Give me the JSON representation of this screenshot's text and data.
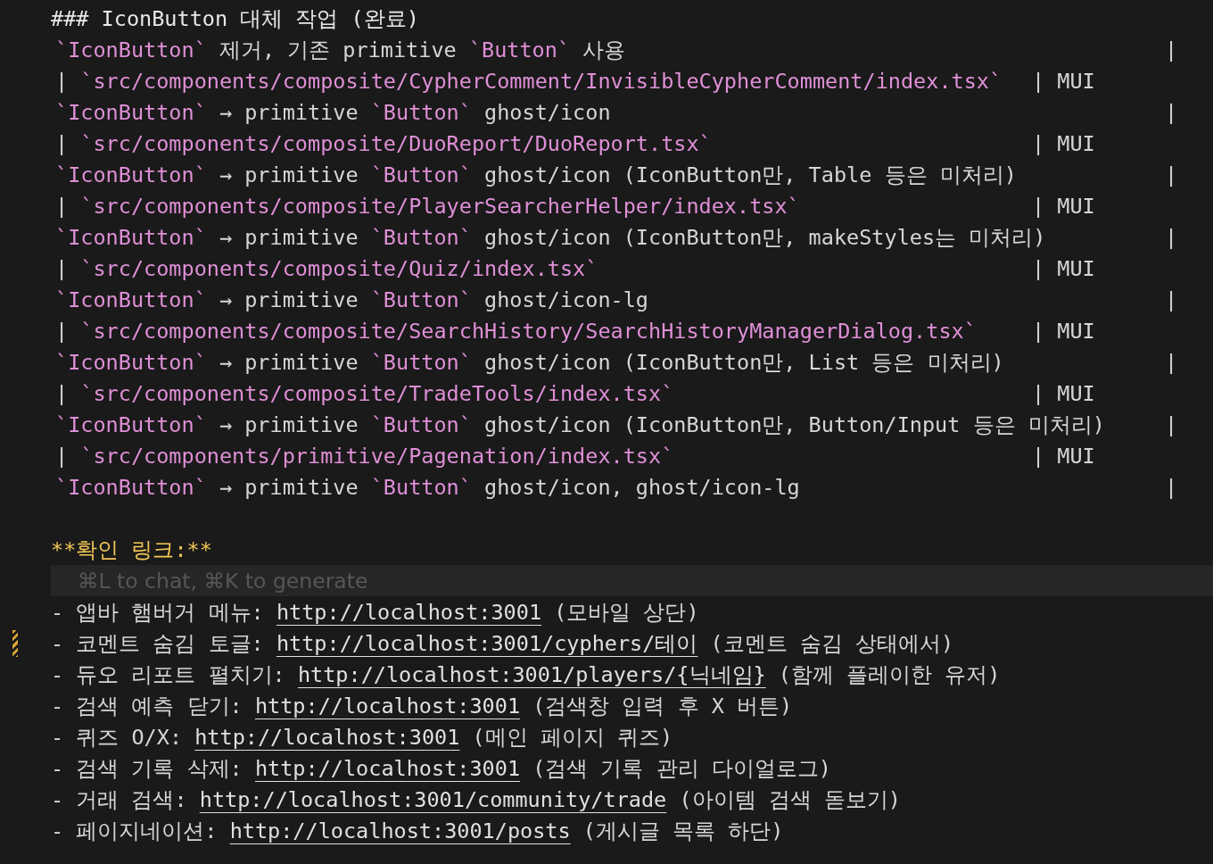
{
  "heading": "### IconButton 대체 작업 (완료)",
  "partial_line": {
    "segments": [
      {
        "kind": "code",
        "text": "`IconButton`"
      },
      {
        "kind": "text",
        "text": " 제거, 기존 primitive "
      },
      {
        "kind": "code",
        "text": "`Button`"
      },
      {
        "kind": "text",
        "text": " 사용"
      }
    ],
    "end_pipe": "|"
  },
  "table_rows": [
    {
      "lead": "|",
      "path": "`src/components/composite/CypherComment/InvisibleCypherComment/index.tsx`",
      "type": "| MUI",
      "description": [
        {
          "kind": "code",
          "text": "`IconButton`"
        },
        {
          "kind": "text",
          "text": " → primitive "
        },
        {
          "kind": "code",
          "text": "`Button`"
        },
        {
          "kind": "text",
          "text": " ghost/icon"
        }
      ],
      "end_pipe": "|"
    },
    {
      "lead": "|",
      "path": "`src/components/composite/DuoReport/DuoReport.tsx`",
      "type": "| MUI",
      "description": [
        {
          "kind": "code",
          "text": "`IconButton`"
        },
        {
          "kind": "text",
          "text": " → primitive "
        },
        {
          "kind": "code",
          "text": "`Button`"
        },
        {
          "kind": "text",
          "text": " ghost/icon (IconButton만, Table 등은 미처리)"
        }
      ],
      "end_pipe": "|"
    },
    {
      "lead": "|",
      "path": "`src/components/composite/PlayerSearcherHelper/index.tsx`",
      "type": "| MUI",
      "description": [
        {
          "kind": "code",
          "text": "`IconButton`"
        },
        {
          "kind": "text",
          "text": " → primitive "
        },
        {
          "kind": "code",
          "text": "`Button`"
        },
        {
          "kind": "text",
          "text": " ghost/icon (IconButton만, makeStyles는 미처리)"
        }
      ],
      "end_pipe": "|"
    },
    {
      "lead": "|",
      "path": "`src/components/composite/Quiz/index.tsx`",
      "type": "| MUI",
      "description": [
        {
          "kind": "code",
          "text": "`IconButton`"
        },
        {
          "kind": "text",
          "text": " → primitive "
        },
        {
          "kind": "code",
          "text": "`Button`"
        },
        {
          "kind": "text",
          "text": " ghost/icon-lg"
        }
      ],
      "end_pipe": "|"
    },
    {
      "lead": "|",
      "path": "`src/components/composite/SearchHistory/SearchHistoryManagerDialog.tsx`",
      "type": "| MUI",
      "description": [
        {
          "kind": "code",
          "text": "`IconButton`"
        },
        {
          "kind": "text",
          "text": " → primitive "
        },
        {
          "kind": "code",
          "text": "`Button`"
        },
        {
          "kind": "text",
          "text": " ghost/icon (IconButton만, List 등은 미처리)"
        }
      ],
      "end_pipe": "|"
    },
    {
      "lead": "|",
      "path": "`src/components/composite/TradeTools/index.tsx`",
      "type": "| MUI",
      "description": [
        {
          "kind": "code",
          "text": "`IconButton`"
        },
        {
          "kind": "text",
          "text": " → primitive "
        },
        {
          "kind": "code",
          "text": "`Button`"
        },
        {
          "kind": "text",
          "text": " ghost/icon (IconButton만, Button/Input 등은 미처리)"
        }
      ],
      "end_pipe": "|"
    },
    {
      "lead": "|",
      "path": "`src/components/primitive/Pagenation/index.tsx`",
      "type": "| MUI",
      "description": [
        {
          "kind": "code",
          "text": "`IconButton`"
        },
        {
          "kind": "text",
          "text": " → primitive "
        },
        {
          "kind": "code",
          "text": "`Button`"
        },
        {
          "kind": "text",
          "text": " ghost/icon, ghost/icon-lg"
        }
      ],
      "end_pipe": "|"
    }
  ],
  "links_label": "**확인 링크:**",
  "ai_hint": "⌘L to chat, ⌘K to generate",
  "links": [
    {
      "bullet": "-",
      "label": "앱바 햄버거 메뉴:",
      "url": "http://localhost:3001",
      "note": "(모바일 상단)",
      "modified": false
    },
    {
      "bullet": "-",
      "label": "코멘트 숨김 토글:",
      "url": "http://localhost:3001/cyphers/테이",
      "note": "(코멘트 숨김 상태에서)",
      "modified": true
    },
    {
      "bullet": "-",
      "label": "듀오 리포트 펼치기:",
      "url": "http://localhost:3001/players/{닉네임}",
      "note": "(함께 플레이한 유저)",
      "modified": false
    },
    {
      "bullet": "-",
      "label": "검색 예측 닫기:",
      "url": "http://localhost:3001",
      "note": "(검색창 입력 후 X 버튼)",
      "modified": false
    },
    {
      "bullet": "-",
      "label": "퀴즈 O/X:",
      "url": "http://localhost:3001",
      "note": "(메인 페이지 퀴즈)",
      "modified": false
    },
    {
      "bullet": "-",
      "label": "검색 기록 삭제:",
      "url": "http://localhost:3001",
      "note": "(검색 기록 관리 다이얼로그)",
      "modified": false
    },
    {
      "bullet": "-",
      "label": "거래 검색:",
      "url": "http://localhost:3001/community/trade",
      "note": "(아이템 검색 돋보기)",
      "modified": false
    },
    {
      "bullet": "-",
      "label": "페이지네이션:",
      "url": "http://localhost:3001/posts",
      "note": "(게시글 목록 하단)",
      "modified": false
    }
  ]
}
